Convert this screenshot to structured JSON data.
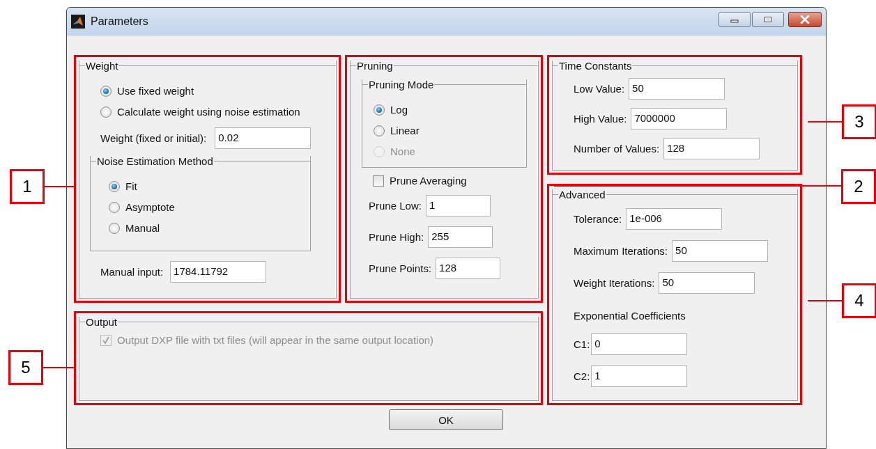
{
  "window": {
    "title": "Parameters"
  },
  "weight_panel": {
    "title": "Weight",
    "highlighted": true,
    "options": [
      {
        "label": "Use fixed weight",
        "selected": true
      },
      {
        "label": "Calculate weight using noise estimation",
        "selected": false
      }
    ],
    "weight_field": {
      "label": "Weight (fixed or initial):",
      "value": "0.02"
    },
    "noise_method": {
      "title": "Noise Estimation Method",
      "options": [
        {
          "label": "Fit",
          "selected": true
        },
        {
          "label": "Asymptote",
          "selected": false
        },
        {
          "label": "Manual",
          "selected": false
        }
      ]
    },
    "manual_input": {
      "label": "Manual input:",
      "value": "1784.11792"
    }
  },
  "pruning_panel": {
    "title": "Pruning",
    "highlighted": true,
    "mode": {
      "title": "Pruning Mode",
      "options": [
        {
          "label": "Log",
          "selected": true,
          "disabled": false
        },
        {
          "label": "Linear",
          "selected": false,
          "disabled": false
        },
        {
          "label": "None",
          "selected": false,
          "disabled": true
        }
      ]
    },
    "averaging": {
      "label": "Prune Averaging",
      "checked": false,
      "disabled": false
    },
    "fields": [
      {
        "label": "Prune Low:",
        "value": "1"
      },
      {
        "label": "Prune High:",
        "value": "255"
      },
      {
        "label": "Prune Points:",
        "value": "128"
      }
    ]
  },
  "time_constants_panel": {
    "title": "Time Constants",
    "highlighted": true,
    "fields": [
      {
        "label": "Low Value:",
        "value": "50"
      },
      {
        "label": "High Value:",
        "value": "7000000"
      },
      {
        "label": "Number of Values:",
        "value": "128"
      }
    ]
  },
  "advanced_panel": {
    "title": "Advanced",
    "highlighted": true,
    "fields": [
      {
        "label": "Tolerance:",
        "value": "1e-006"
      },
      {
        "label": "Maximum Iterations:",
        "value": "50"
      },
      {
        "label": "Weight Iterations:",
        "value": "50"
      }
    ],
    "coefficients_heading": "Exponential Coefficients",
    "coefficients": [
      {
        "label": "C1:",
        "value": "0"
      },
      {
        "label": "C2:",
        "value": "1"
      }
    ]
  },
  "output_panel": {
    "title": "Output",
    "highlighted": true,
    "option": {
      "label": "Output DXP file with txt files (will appear in the same output location)",
      "checked": true,
      "disabled": true
    }
  },
  "buttons": [
    "OK"
  ],
  "callouts": [
    {
      "number": "3"
    },
    {
      "number": "1"
    },
    {
      "number": "2"
    },
    {
      "number": "4"
    },
    {
      "number": "5"
    }
  ]
}
